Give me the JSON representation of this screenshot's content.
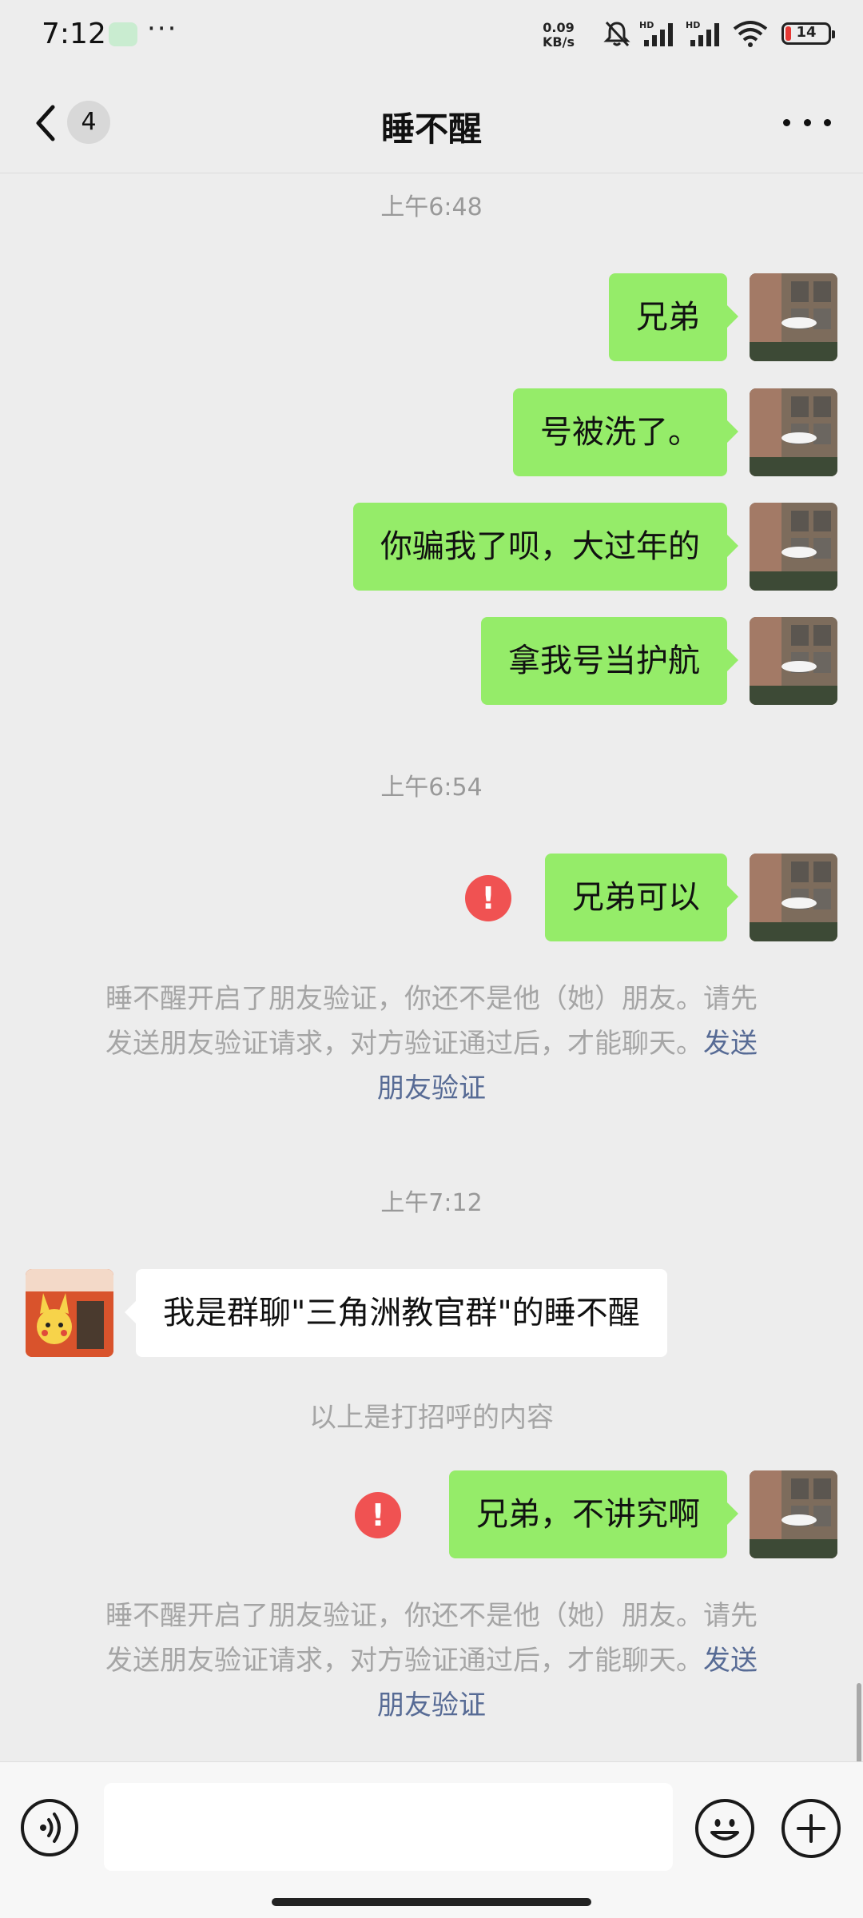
{
  "status_bar": {
    "time": "7:12",
    "more": "···",
    "net_speed_value": "0.09",
    "net_speed_unit": "KB/s",
    "battery": "14",
    "icons": [
      "wechat-notify-icon",
      "mute-bell-icon",
      "signal-hd-icon",
      "signal-hd-icon",
      "wifi-icon",
      "battery-icon"
    ]
  },
  "header": {
    "back_badge": "4",
    "title": "睡不醒",
    "icons": [
      "chevron-left-icon",
      "more-dots-icon"
    ]
  },
  "chat": {
    "time_1": "上午6:48",
    "msg_1": "兄弟",
    "msg_2": "号被洗了。",
    "msg_3": "你骗我了呗，大过年的",
    "msg_4": "拿我号当护航",
    "time_2": "上午6:54",
    "msg_5": "兄弟可以",
    "msg_5_error": "!",
    "notice_1": {
      "line_1": "睡不醒开启了朋友验证，你还不是他（她）朋友。请先",
      "line_2": "发送朋友验证请求，对方验证通过后，才能聊天。",
      "link_part_1": "发送",
      "link_part_2": "朋友验证"
    },
    "time_3": "上午7:12",
    "greeting": "我是群聊\"三角洲教官群\"的睡不醒",
    "greeting_note": "以上是打招呼的内容",
    "msg_6": "兄弟，不讲究啊",
    "msg_6_error": "!",
    "notice_2": {
      "line_1": "睡不醒开启了朋友验证，你还不是他（她）朋友。请先",
      "line_2": "发送朋友验证请求，对方验证通过后，才能聊天。",
      "link_part_1": "发送",
      "link_part_2": "朋友验证"
    }
  },
  "input_bar": {
    "value": "",
    "icons": [
      "voice-icon",
      "emoji-icon",
      "plus-icon"
    ]
  },
  "colors": {
    "background": "#ededed",
    "my_bubble": "#95ec69",
    "other_bubble": "#ffffff",
    "link": "#576b95",
    "error": "#f05252"
  }
}
